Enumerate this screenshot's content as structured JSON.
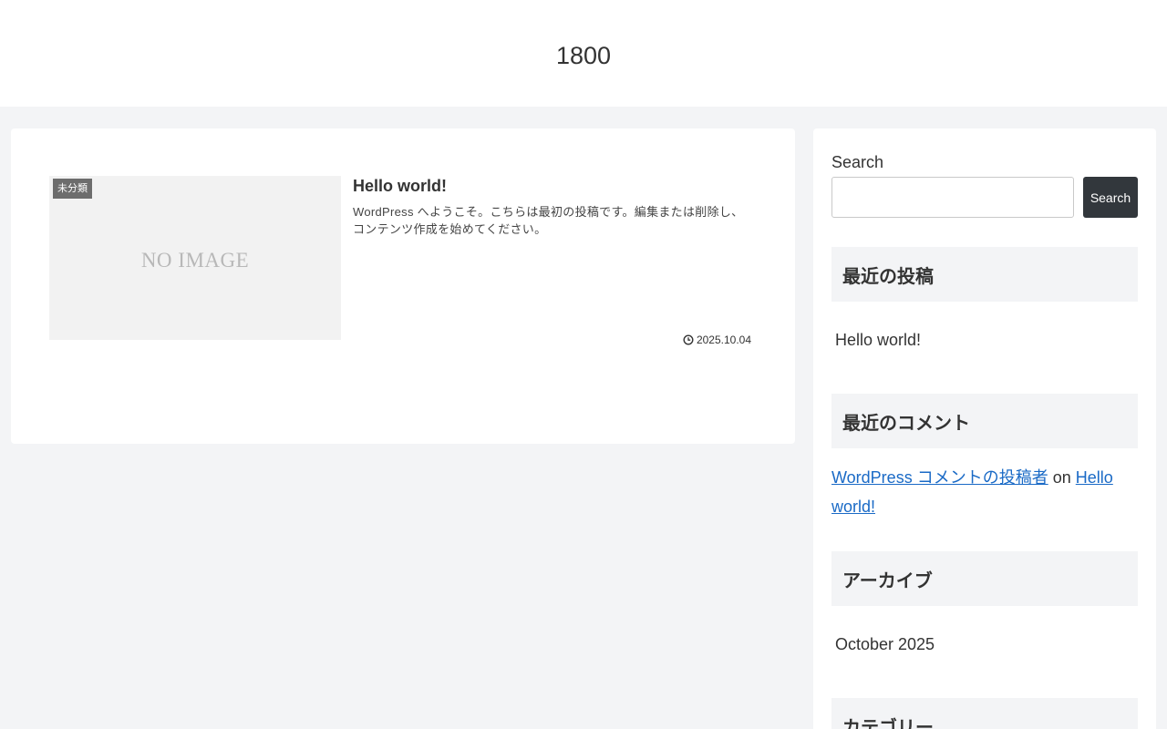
{
  "header": {
    "site_title": "1800"
  },
  "main": {
    "post": {
      "category": "未分類",
      "thumbnail_text": "NO IMAGE",
      "title": "Hello world!",
      "snippet": "WordPress へようこそ。こちらは最初の投稿です。編集または削除し、コンテンツ作成を始めてください。",
      "date": "2025.10.04"
    }
  },
  "sidebar": {
    "search": {
      "label": "Search",
      "button_label": "Search",
      "placeholder": ""
    },
    "recent_posts": {
      "title": "最近の投稿",
      "items": [
        "Hello world!"
      ]
    },
    "recent_comments": {
      "title": "最近のコメント",
      "author": "WordPress コメントの投稿者",
      "connector": "on",
      "post": "Hello world!"
    },
    "archives": {
      "title": "アーカイブ",
      "items": [
        "October 2025"
      ]
    },
    "categories": {
      "title": "カテゴリー"
    }
  },
  "colors": {
    "page_background": "#f3f4f6",
    "search_button": "#32373c",
    "link": "#1a6ac6",
    "category_label": "#6d6d6d"
  }
}
